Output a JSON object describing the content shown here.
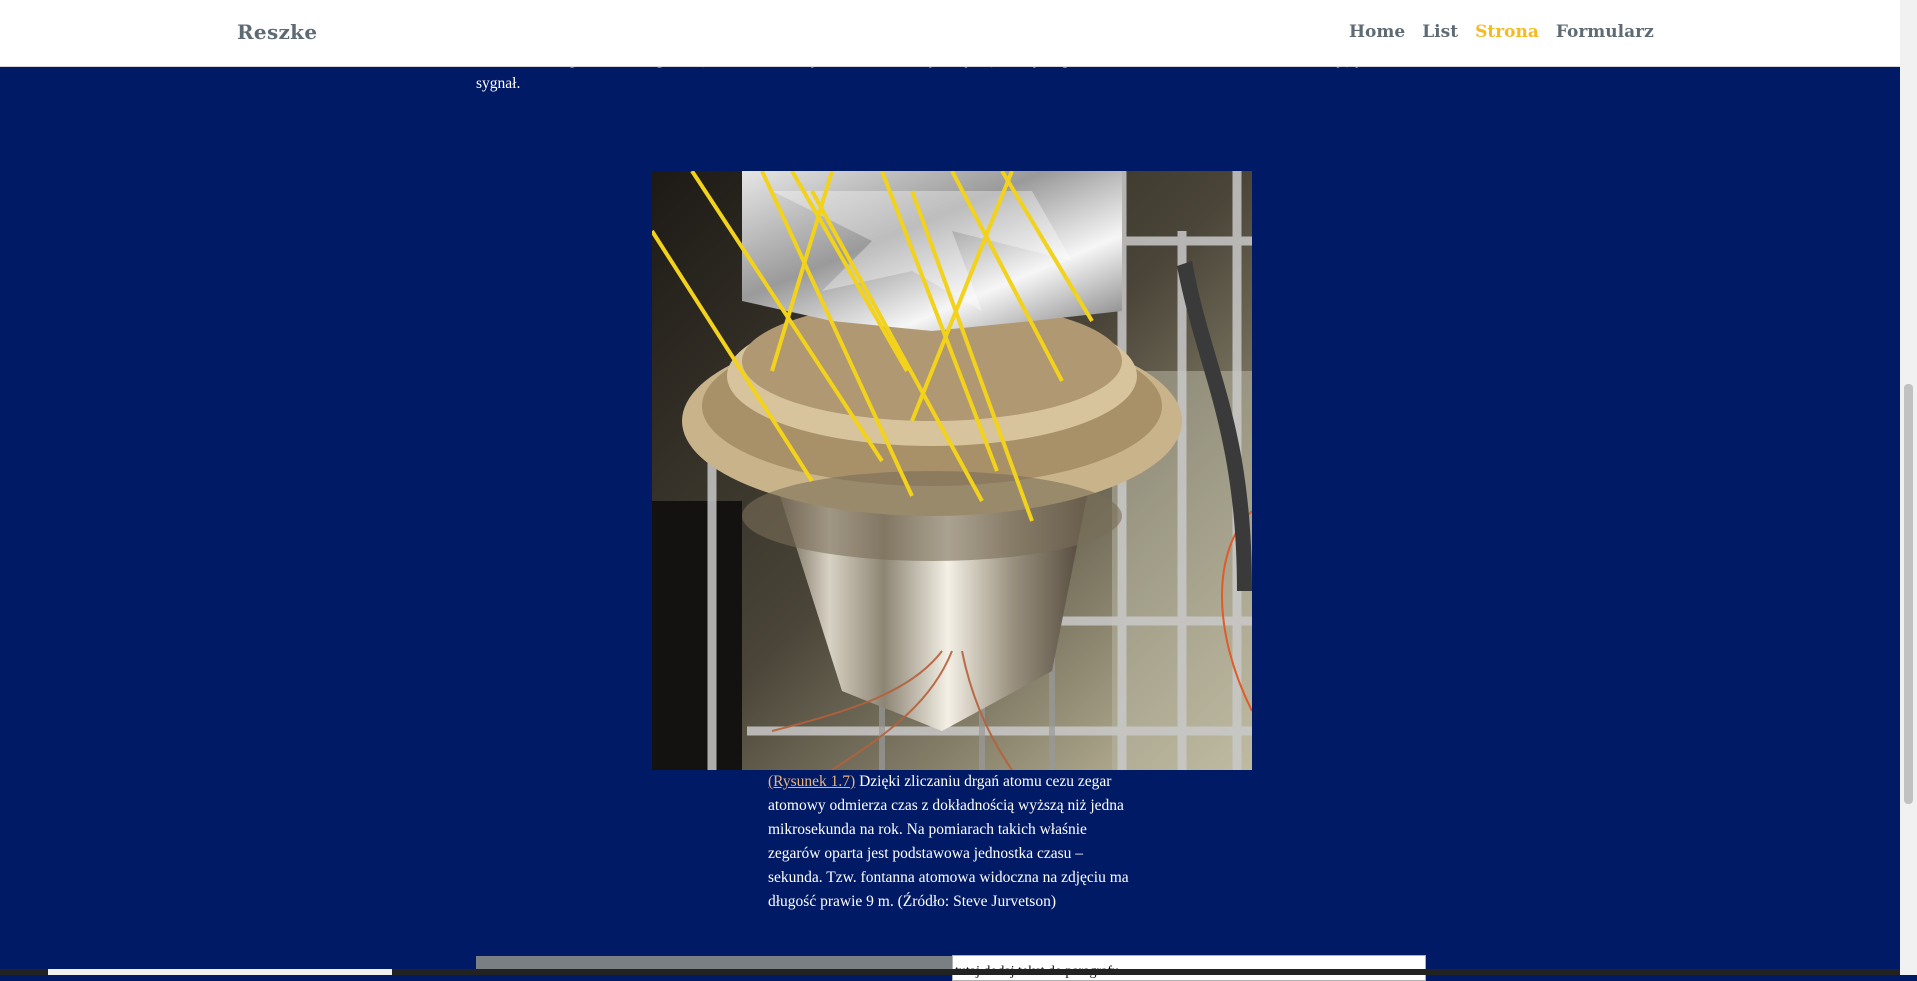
{
  "header": {
    "brand": "Reszke",
    "nav": [
      {
        "label": "Home",
        "active": false
      },
      {
        "label": "List",
        "active": false
      },
      {
        "label": "Strona",
        "active": true
      },
      {
        "label": "Formularz",
        "active": false
      }
    ]
  },
  "article": {
    "paragraph": "dokładności zegara atomowego, dzięki czemu możemy odbierać instrukcje dotyczące trasy na powierzchni Ziemi, z dala od satelitów nadających sygnał.",
    "figure": {
      "image_alt": "fontanna atomowa",
      "caption_link": "(Rysunek 1.7)",
      "caption_text": " Dzięki zliczaniu drgań atomu cezu zegar atomowy odmierza czas z dokładnością wyższą niż jedna mikrosekunda na rok. Na pomiarach takich właśnie zegarów oparta jest podstawowa jednostka czasu – sekunda. Tzw. fontanna atomowa widoczna na zdjęciu ma długość prawie 9 m. (Źródło: Steve Jurvetson)"
    }
  },
  "form": {
    "paragraph_input_value": "tutaj dodaj tekst do paragrafu"
  },
  "colors": {
    "background": "#001a66",
    "accent": "#f5b921",
    "nav_text": "#5f6b74",
    "link": "#e8b478"
  }
}
